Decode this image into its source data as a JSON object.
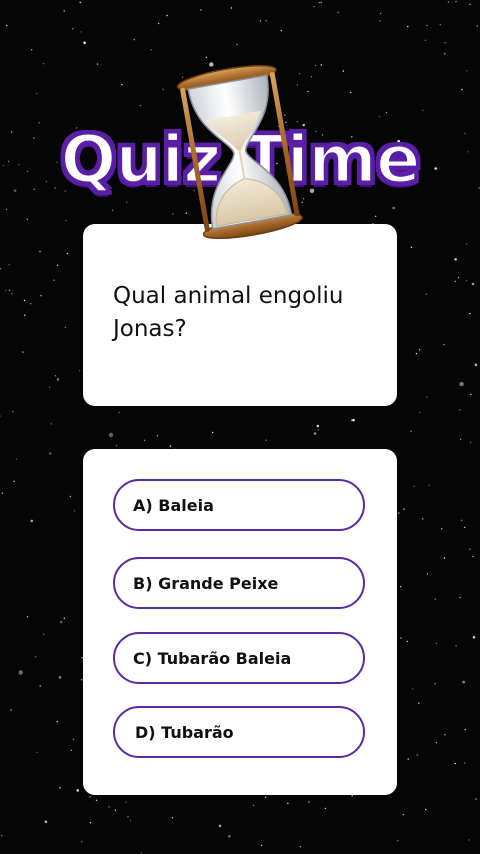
{
  "header": {
    "title": "Quiz Time"
  },
  "question": {
    "text": "Qual animal engoliu Jonas?"
  },
  "answers": [
    {
      "label": "A) Baleia"
    },
    {
      "label": "B) Grande Peixe"
    },
    {
      "label": "C) Tubarão Baleia"
    },
    {
      "label": "D) Tubarão"
    }
  ],
  "colors": {
    "accent_purple": "#5a2aa0",
    "title_outline": "#5a1fa6",
    "card_bg": "#ffffff",
    "background": "#050505"
  },
  "icons": {
    "hourglass": "hourglass-icon"
  }
}
